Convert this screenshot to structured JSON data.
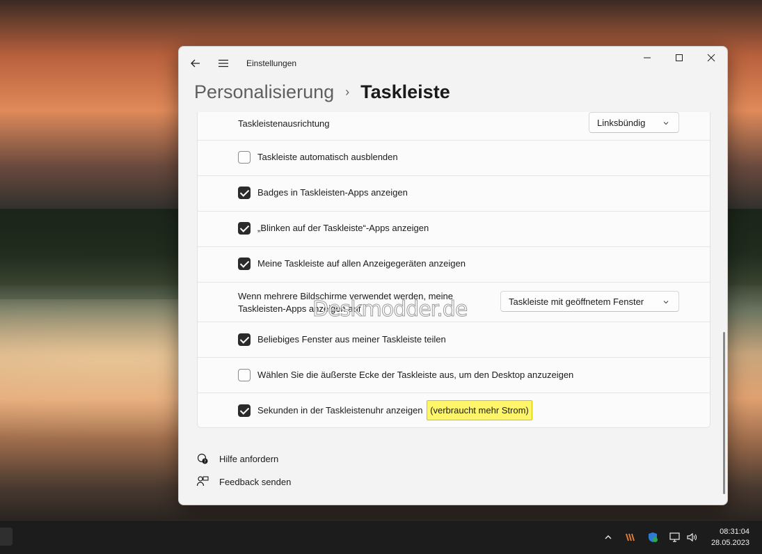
{
  "window": {
    "app_title": "Einstellungen",
    "controls": {
      "minimize": "—",
      "maximize": "☐",
      "close": "✕"
    }
  },
  "breadcrumb": {
    "parent": "Personalisierung",
    "separator": "›",
    "current": "Taskleiste"
  },
  "settings": {
    "alignment": {
      "label": "Taskleistenausrichtung",
      "value": "Linksbündig"
    },
    "auto_hide": {
      "label": "Taskleiste automatisch ausblenden",
      "checked": false
    },
    "badges": {
      "label": "Badges in Taskleisten-Apps anzeigen",
      "checked": true
    },
    "flashing": {
      "label": "„Blinken auf der Taskleiste“-Apps anzeigen",
      "checked": true
    },
    "all_displays": {
      "label": "Meine Taskleiste auf allen Anzeigegeräten anzeigen",
      "checked": true
    },
    "multi_display": {
      "label_line1": "Wenn mehrere Bildschirme verwendet werden, meine",
      "label_line2": "Taskleisten-Apps anzeigen auf",
      "value": "Taskleiste mit geöffnetem Fenster"
    },
    "share_window": {
      "label": "Beliebiges Fenster aus meiner Taskleiste teilen",
      "checked": true
    },
    "corner_desktop": {
      "label": "Wählen Sie die äußerste Ecke der Taskleiste aus, um den Desktop anzuzeigen",
      "checked": false
    },
    "seconds_clock": {
      "label": "Sekunden in der Taskleistenuhr anzeigen",
      "highlight": "(verbraucht mehr Strom)",
      "checked": true
    }
  },
  "watermark": "Deskmodder.de",
  "links": {
    "help": "Hilfe anfordern",
    "feedback": "Feedback senden"
  },
  "taskbar": {
    "time": "08:31:04",
    "date": "28.05.2023"
  },
  "colors": {
    "checked": "#2b2b2b",
    "highlight": "#fff56a",
    "taskbar": "#1c1c1c"
  }
}
